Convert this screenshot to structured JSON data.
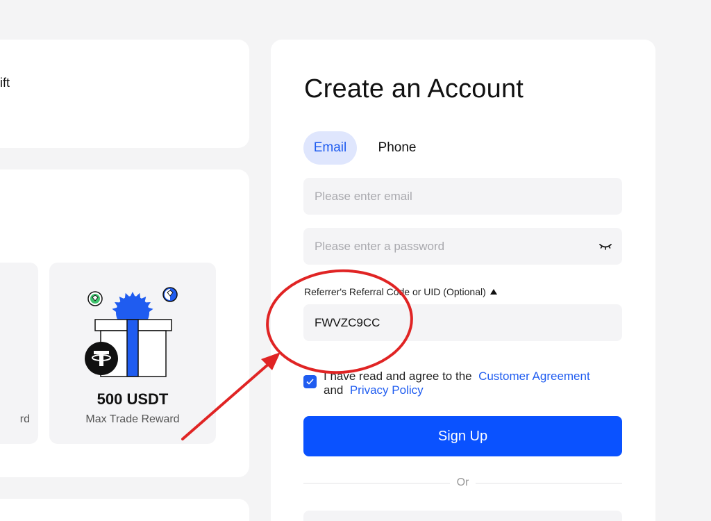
{
  "left": {
    "banner_text": "ift",
    "tile_left_sub": "rd",
    "tile_main_amount": "500 USDT",
    "tile_main_sub": "Max Trade Reward"
  },
  "signup": {
    "title": "Create an Account",
    "tabs": [
      {
        "label": "Email",
        "active": true
      },
      {
        "label": "Phone",
        "active": false
      }
    ],
    "email_placeholder": "Please enter email",
    "password_placeholder": "Please enter a password",
    "referral_label": "Referrer's Referral Code or UID (Optional)",
    "referral_value": "FWVZC9CC",
    "agree_text": "I have read and agree to the",
    "customer_agreement": "Customer Agreement",
    "and_text": "and",
    "privacy_policy": "Privacy Policy",
    "signup_label": "Sign Up",
    "or_label": "Or"
  },
  "colors": {
    "accent": "#0a52ff",
    "link": "#1f5cf0",
    "annotation": "#e02424"
  },
  "icons": {
    "password_toggle": "eye-closed-icon",
    "referral_toggle": "caret-up-icon",
    "checkbox": "check-icon",
    "tether": "tether-icon"
  }
}
